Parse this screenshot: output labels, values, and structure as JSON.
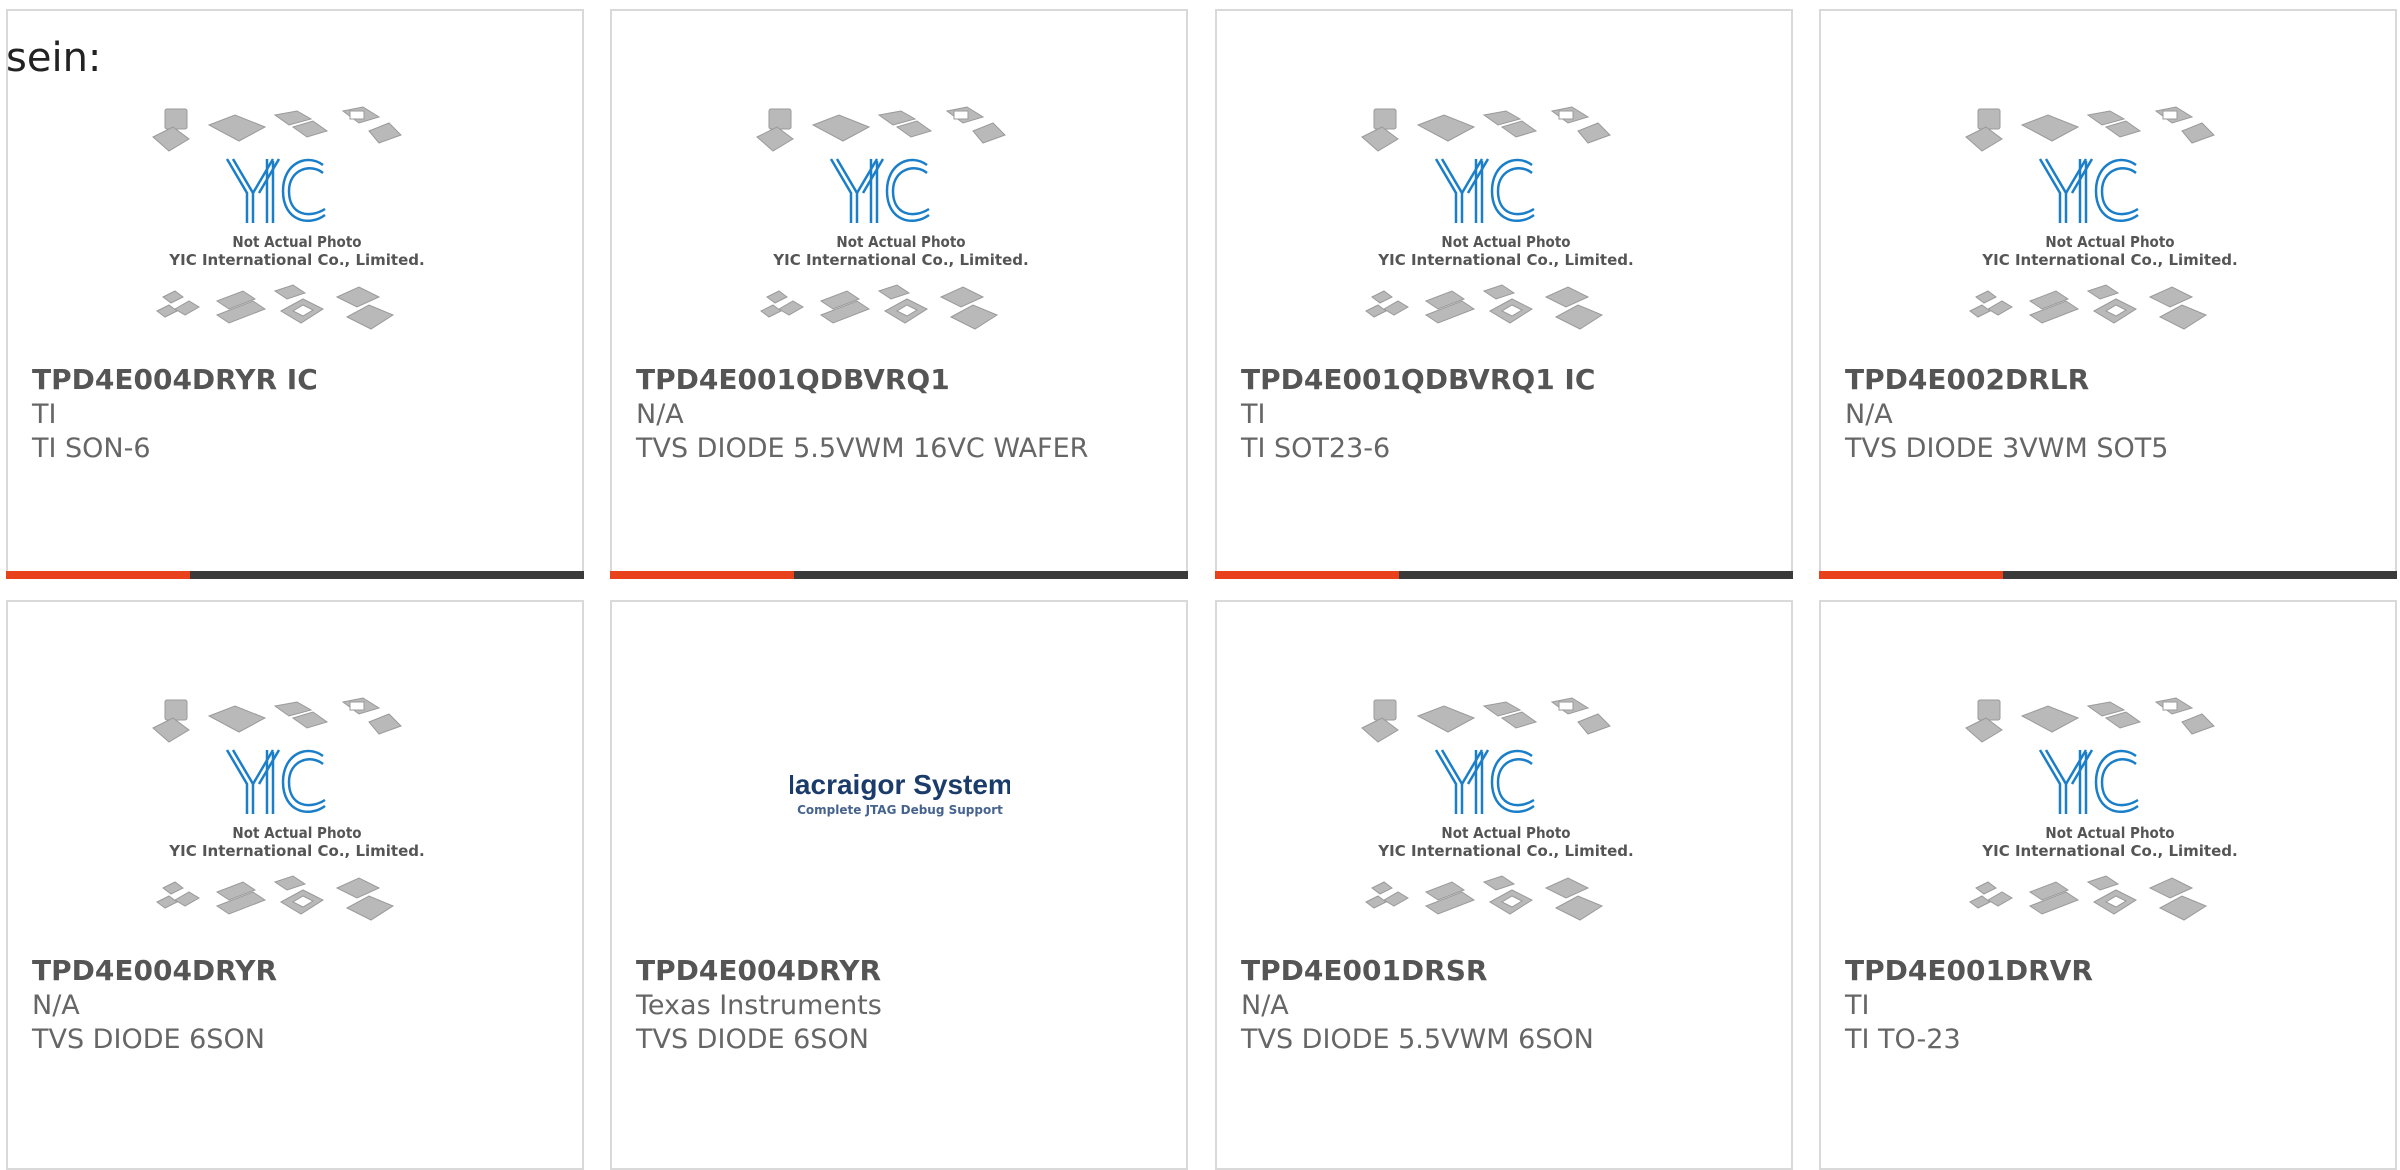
{
  "page": {
    "heading_fragment": "sein:"
  },
  "theme": {
    "accent_color": "#e8411b",
    "bar_color": "#3a3a3a",
    "yic_blue": "#1a7ec8"
  },
  "placeholder_image": {
    "line1": "Not Actual Photo",
    "line2": "YIC International Co., Limited.",
    "logo_text": "YIC"
  },
  "macraigor_logo": {
    "name": "Macraigor Systems",
    "tagline": "Complete JTAG Debug Support"
  },
  "products": [
    {
      "part": "TPD4E004DRYR IC",
      "manufacturer": "TI",
      "description": "TI SON-6",
      "image": "yic-placeholder"
    },
    {
      "part": "TPD4E001QDBVRQ1",
      "manufacturer": "N/A",
      "description": "TVS DIODE 5.5VWM 16VC WAFER",
      "image": "yic-placeholder"
    },
    {
      "part": "TPD4E001QDBVRQ1 IC",
      "manufacturer": "TI",
      "description": "TI SOT23-6",
      "image": "yic-placeholder"
    },
    {
      "part": "TPD4E002DRLR",
      "manufacturer": "N/A",
      "description": "TVS DIODE 3VWM SOT5",
      "image": "yic-placeholder"
    },
    {
      "part": "TPD4E004DRYR",
      "manufacturer": "N/A",
      "description": "TVS DIODE 6SON",
      "image": "yic-placeholder"
    },
    {
      "part": "TPD4E004DRYR",
      "manufacturer": "Texas Instruments",
      "description": "TVS DIODE 6SON",
      "image": "macraigor-logo"
    },
    {
      "part": "TPD4E001DRSR",
      "manufacturer": "N/A",
      "description": "TVS DIODE 5.5VWM 6SON",
      "image": "yic-placeholder"
    },
    {
      "part": "TPD4E001DRVR",
      "manufacturer": "TI",
      "description": "TI TO-23",
      "image": "yic-placeholder"
    }
  ]
}
